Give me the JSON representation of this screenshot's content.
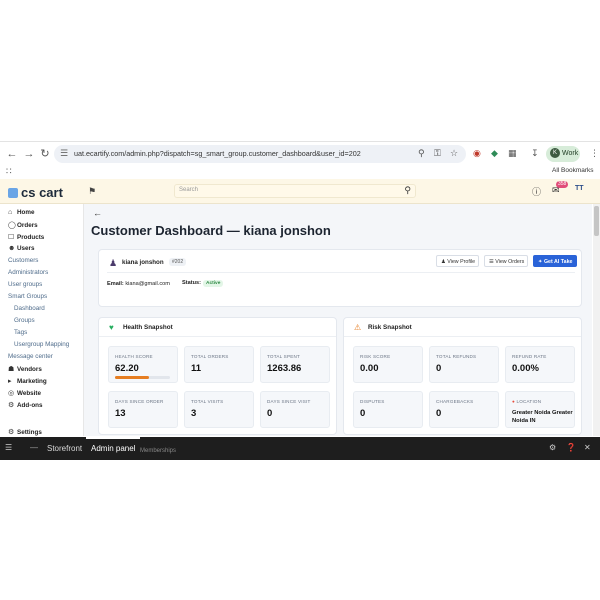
{
  "browser": {
    "url": "uat.ecartify.com/admin.php?dispatch=sg_smart_group.customer_dashboard&user_id=202",
    "profile_label": "Work",
    "profile_initial": "K",
    "all_bookmarks": "All Bookmarks"
  },
  "header": {
    "logo_text": "cs cart",
    "search_placeholder": "Search",
    "notification_count": "358",
    "user_initials": "TT"
  },
  "sidebar": {
    "items": [
      {
        "label": "Home",
        "icon": "home-icon"
      },
      {
        "label": "Orders",
        "icon": "orders-icon"
      },
      {
        "label": "Products",
        "icon": "products-icon"
      },
      {
        "label": "Users",
        "icon": "users-icon"
      },
      {
        "label": "Customers"
      },
      {
        "label": "Administrators"
      },
      {
        "label": "User groups"
      },
      {
        "label": "Smart Groups"
      },
      {
        "label": "Dashboard"
      },
      {
        "label": "Groups"
      },
      {
        "label": "Tags"
      },
      {
        "label": "Usergroup Mapping"
      },
      {
        "label": "Message center"
      },
      {
        "label": "Vendors",
        "icon": "vendors-icon"
      },
      {
        "label": "Marketing",
        "icon": "marketing-icon"
      },
      {
        "label": "Website",
        "icon": "website-icon"
      },
      {
        "label": "Add-ons",
        "icon": "addons-icon"
      },
      {
        "label": "Settings",
        "icon": "settings-icon"
      }
    ]
  },
  "page": {
    "title": "Customer Dashboard — kiana jonshon"
  },
  "profile": {
    "name": "kiana jonshon",
    "id_badge": "#202",
    "view_profile": "View Profile",
    "view_orders": "View Orders",
    "ai_take": "Get AI Take",
    "email_label": "Email:",
    "email": "kiana@gmail.com",
    "status_label": "Status:",
    "status": "Active",
    "status_color": "#2f8a45"
  },
  "health": {
    "title": "Health Snapshot",
    "metrics": [
      {
        "label": "HEALTH SCORE",
        "value": "62.20"
      },
      {
        "label": "TOTAL ORDERS",
        "value": "11"
      },
      {
        "label": "TOTAL SPENT",
        "value": "1263.86"
      },
      {
        "label": "DAYS SINCE ORDER",
        "value": "13"
      },
      {
        "label": "TOTAL VISITS",
        "value": "3"
      },
      {
        "label": "DAYS SINCE VISIT",
        "value": "0"
      }
    ],
    "score_fraction": 0.622,
    "score_bar_color": "#e67e22"
  },
  "risk": {
    "title": "Risk Snapshot",
    "metrics": [
      {
        "label": "RISK SCORE",
        "value": "0.00"
      },
      {
        "label": "TOTAL REFUNDS",
        "value": "0"
      },
      {
        "label": "REFUND RATE",
        "value": "0.00%"
      },
      {
        "label": "DISPUTES",
        "value": "0"
      },
      {
        "label": "CHARGEBACKS",
        "value": "0"
      },
      {
        "label": "LOCATION",
        "value": "Greater Noida Greater Noida IN"
      }
    ]
  },
  "bottombar": {
    "storefront": "Storefront",
    "admin_panel": "Admin panel",
    "ghost_text": "Memberships"
  }
}
